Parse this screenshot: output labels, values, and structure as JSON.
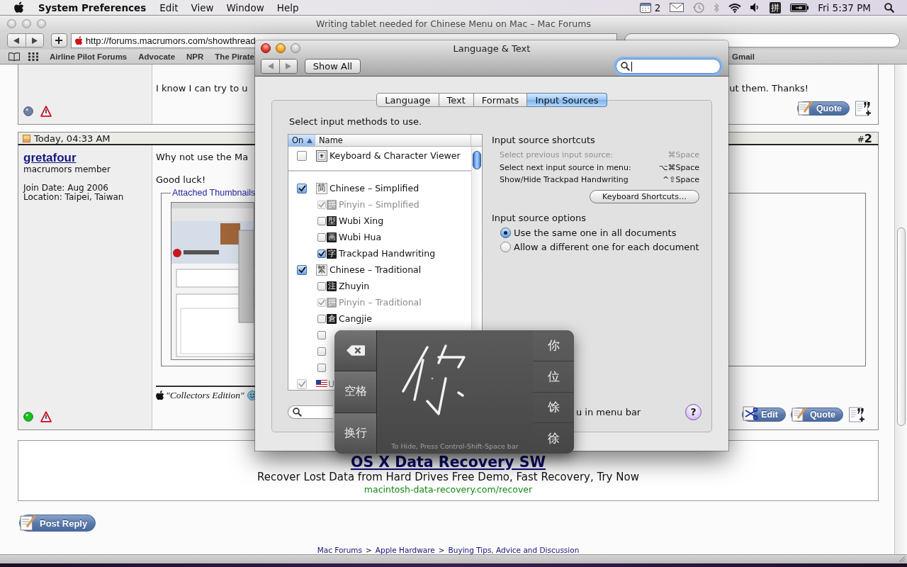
{
  "menu_bar": {
    "app_name": "System Preferences",
    "menus": [
      "Edit",
      "View",
      "Window",
      "Help"
    ],
    "calendar_count": "2",
    "input_glyph": "拼",
    "clock": "Fri 5:37 PM"
  },
  "browser": {
    "title": "Writing tablet needed for Chinese Menu on Mac – Mac Forums",
    "url": "http://forums.macrumors.com/showthread",
    "bookmarks": [
      "Airline Pilot Forums",
      "Advocate",
      "NPR",
      "The Pirate"
    ],
    "bookmarks_far": [
      "Gmail"
    ]
  },
  "previous_post": {
    "online": false,
    "text_left": "I know I can try to u",
    "text_right": "ut them. Thanks!",
    "buttons": [
      {
        "kind": "quote",
        "label": "Quote"
      }
    ]
  },
  "post": {
    "date": "Today, 04:33 AM",
    "number": "#**2**",
    "author": "gretafour",
    "rank": "macrumors member",
    "join_date": "Join Date: Aug 2006",
    "location": "Location: Taipei, Taiwan",
    "online": true,
    "lines": [
      "Why not use the Ma",
      "Good luck!"
    ],
    "attachments_legend": "Attached Thumbnails",
    "signature": "\"Collectors Edition\"",
    "buttons": [
      {
        "kind": "edit",
        "label": "Edit"
      },
      {
        "kind": "quote",
        "label": "Quote"
      }
    ]
  },
  "ad": {
    "title": "OS X Data Recovery SW",
    "description": "Recover Lost Data from Hard Drives Free Demo, Fast Recovery, Try Now",
    "url": "macintosh-data-recovery.com/recover"
  },
  "post_reply": "Post Reply",
  "breadcrumb": {
    "links": [
      "Mac Forums",
      "Apple Hardware",
      "Buying Tips, Advice and Discussion"
    ],
    "separator": ">"
  },
  "prefs_window": {
    "title": "Language & Text",
    "show_all": "Show All",
    "tabs": [
      {
        "label": "Language",
        "selected": false
      },
      {
        "label": "Text",
        "selected": false
      },
      {
        "label": "Formats",
        "selected": false
      },
      {
        "label": "Input Sources",
        "selected": true
      }
    ],
    "instruction": "Select input methods to use.",
    "list": {
      "columns": [
        {
          "label": "On",
          "selected": true
        },
        {
          "label": "Name",
          "selected": false
        }
      ],
      "pinned": [
        {
          "label": "Keyboard & Character Viewer",
          "checked": false
        }
      ],
      "items": [
        {
          "kind": "glyph",
          "glyph": "简",
          "label": "Chinese – Simplified",
          "checked": true,
          "disabled": false,
          "children": [
            {
              "kind": "glyph",
              "glyph": "拼",
              "label": "Pinyin – Simplified",
              "checked": true,
              "disabled": true
            },
            {
              "kind": "glyph",
              "glyph": "型",
              "label": "Wubi Xing",
              "checked": false,
              "disabled": false
            },
            {
              "kind": "glyph",
              "glyph": "画",
              "label": "Wubi Hua",
              "checked": false,
              "disabled": false
            },
            {
              "kind": "glyph",
              "glyph": "字",
              "label": "Trackpad Handwriting",
              "checked": true,
              "disabled": false
            }
          ]
        },
        {
          "kind": "glyph",
          "glyph": "繁",
          "label": "Chinese – Traditional",
          "checked": true,
          "disabled": false,
          "children": [
            {
              "kind": "glyph",
              "glyph": "注",
              "label": "Zhuyin",
              "checked": false,
              "disabled": false
            },
            {
              "kind": "glyph",
              "glyph": "拼",
              "label": "Pinyin – Traditional",
              "checked": true,
              "disabled": true
            },
            {
              "kind": "glyph",
              "glyph": "倉",
              "label": "Cangjie",
              "checked": false,
              "disabled": false
            },
            {
              "kind": "glyph",
              "checked": false,
              "disabled": false
            },
            {
              "kind": "glyph",
              "checked": false,
              "disabled": false
            },
            {
              "kind": "glyph",
              "checked": false,
              "disabled": false
            }
          ]
        },
        {
          "kind": "flag",
          "label": "U",
          "checked": true,
          "disabled": true
        }
      ]
    },
    "shortcuts_heading": "Input source shortcuts",
    "shortcuts": [
      {
        "label": "Select previous input source:",
        "keys": "⌘Space",
        "disabled": true
      },
      {
        "label": "Select next input source in menu:",
        "keys": "⌥⌘Space",
        "disabled": false
      },
      {
        "label": "Show/Hide Trackpad Handwriting",
        "keys": "^⇧Space",
        "disabled": false
      }
    ],
    "shortcuts_button": "Keyboard Shortcuts…",
    "options_heading": "Input source options",
    "options": [
      {
        "label": "Use the same one in all documents",
        "selected": true
      },
      {
        "label": "Allow a different one for each document",
        "selected": false
      }
    ],
    "menu_bar_option": "u in menu bar",
    "help": "?"
  },
  "handwriting_panel": {
    "keys": [
      "空格",
      "换行"
    ],
    "candidates": [
      "你",
      "位",
      "馀",
      "徐"
    ],
    "hint": "To Hide, Press Control-Shift-Space bar"
  }
}
